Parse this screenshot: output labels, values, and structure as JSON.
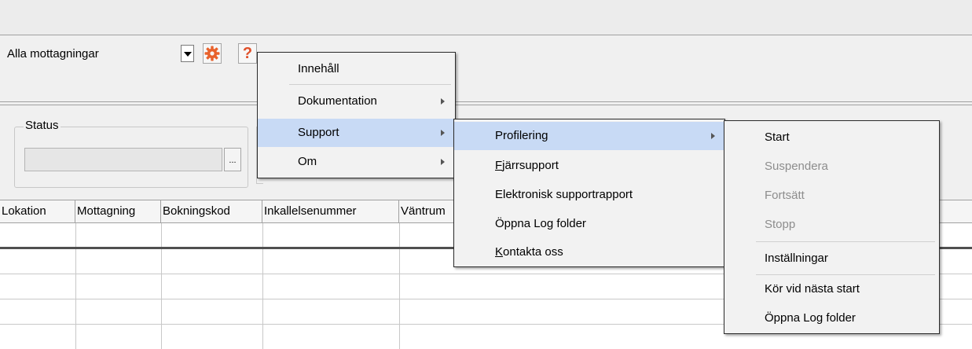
{
  "toolbar": {
    "dropdown_value": "Alla mottagningar",
    "settings_icon": "gear-icon",
    "help_icon": "question-icon",
    "help_glyph": "?"
  },
  "status": {
    "label": "Status",
    "field_value": "",
    "browse_label": "..."
  },
  "table": {
    "columns": [
      "Lokation",
      "Mottagning",
      "Bokningskod",
      "Inkallelsenummer",
      "Väntrum"
    ]
  },
  "help_menu": {
    "items": [
      "Innehåll",
      "Dokumentation",
      "Support",
      "Om"
    ],
    "highlighted": "Support"
  },
  "support_menu": {
    "profilering": "Profilering",
    "fjarrsupport_first": "F",
    "fjarrsupport_rest": "järrsupport",
    "elektronisk": "Elektronisk supportrapport",
    "oppna_log": "Öppna Log folder",
    "kontakta_first": "K",
    "kontakta_rest": "ontakta oss",
    "highlighted": "Profilering"
  },
  "profilering_menu": {
    "start": "Start",
    "suspendera": "Suspendera",
    "fortsatt": "Fortsätt",
    "stopp": "Stopp",
    "installningar": "Inställningar",
    "kor_vid": "Kör vid nästa start",
    "oppna_log": "Öppna Log folder"
  },
  "colors": {
    "menu_highlight": "#c8daf5",
    "gear": "#e8622c",
    "help": "#e0502a",
    "disabled_text": "#8d8d8d"
  }
}
